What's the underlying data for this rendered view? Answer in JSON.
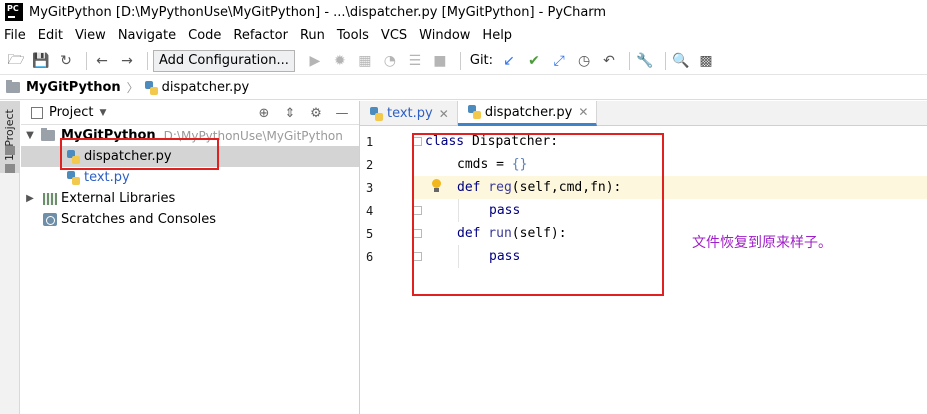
{
  "window": {
    "title": "MyGitPython [D:\\MyPythonUse\\MyGitPython] - ...\\dispatcher.py [MyGitPython] - PyCharm",
    "logo": "PC"
  },
  "menu": [
    "File",
    "Edit",
    "View",
    "Navigate",
    "Code",
    "Refactor",
    "Run",
    "Tools",
    "VCS",
    "Window",
    "Help"
  ],
  "toolbar": {
    "add_config": "Add Configuration...",
    "git_label": "Git:"
  },
  "breadcrumb": {
    "project": "MyGitPython",
    "file": "dispatcher.py"
  },
  "side_tab": "1: Project",
  "project_panel": {
    "title": "Project",
    "root": {
      "name": "MyGitPython",
      "path": "D:\\MyPythonUse\\MyGitPython"
    },
    "files": [
      "dispatcher.py",
      "text.py"
    ],
    "external": "External Libraries",
    "scratches": "Scratches and Consoles"
  },
  "tabs": [
    {
      "label": "text.py"
    },
    {
      "label": "dispatcher.py"
    }
  ],
  "code": {
    "line_numbers": [
      "1",
      "2",
      "3",
      "4",
      "5",
      "6"
    ],
    "lines": [
      {
        "kw": "class",
        "rest": " Dispatcher:"
      },
      {
        "name": "cmds",
        "op": " = ",
        "val": "{}"
      },
      {
        "kw": "def",
        "fn": " reg",
        "rest": "(self,cmd,fn):"
      },
      {
        "kw": "pass"
      },
      {
        "kw": "def",
        "fn": " run",
        "rest": "(self):"
      },
      {
        "kw": "pass"
      }
    ]
  },
  "annotation": "文件恢复到原来样子。"
}
